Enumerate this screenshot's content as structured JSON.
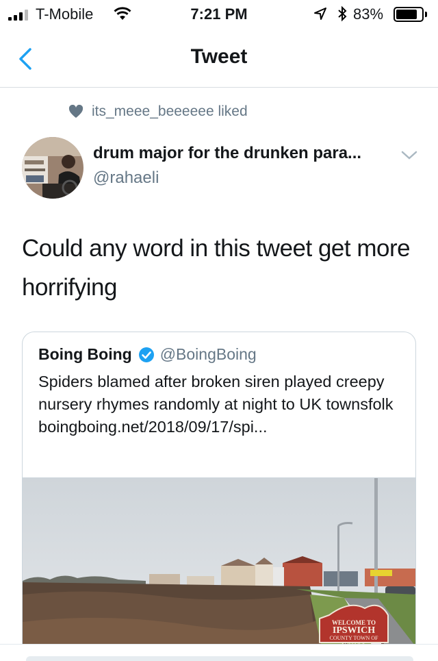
{
  "status_bar": {
    "carrier": "T-Mobile",
    "time": "7:21 PM",
    "battery_percent": "83%",
    "battery_level": 0.83,
    "icons": [
      "signal-icon",
      "wifi-icon",
      "location-arrow-icon",
      "bluetooth-icon",
      "battery-icon"
    ]
  },
  "nav": {
    "title": "Tweet",
    "back_icon": "chevron-left-icon"
  },
  "social_context": {
    "icon": "heart-icon",
    "text": "its_meee_beeeeee liked"
  },
  "tweet": {
    "display_name": "drum major for the drunken para...",
    "handle": "@rahaeli",
    "text": "Could any word in this tweet get more horrifying",
    "menu_icon": "chevron-down-icon"
  },
  "quoted_tweet": {
    "name": "Boing Boing",
    "verified_icon": "verified-badge-icon",
    "handle": "@BoingBoing",
    "text": "Spiders blamed after broken siren played creepy nursery rhymes randomly at night to UK townsfolk boingboing.net/2018/09/17/spi...",
    "sign_text": [
      "WELCOME TO",
      "IPSWICH",
      "COUNTY TOWN OF",
      "SUFFOLK"
    ]
  },
  "colors": {
    "accent": "#1da1f2",
    "muted": "#657786",
    "border": "#ccd6dd"
  }
}
